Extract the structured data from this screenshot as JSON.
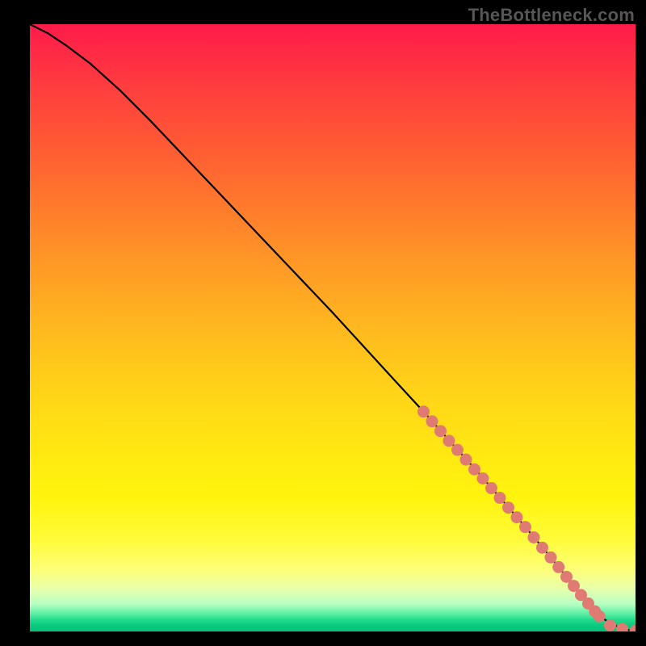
{
  "watermark": "TheBottleneck.com",
  "chart_data": {
    "type": "line",
    "title": "",
    "xlabel": "",
    "ylabel": "",
    "xlim": [
      0,
      100
    ],
    "ylim": [
      0,
      100
    ],
    "grid": false,
    "series": [
      {
        "name": "curve",
        "color": "#000000",
        "x": [
          0,
          3,
          6,
          10,
          15,
          20,
          30,
          40,
          50,
          60,
          65,
          70,
          74,
          78,
          82,
          86,
          89,
          91,
          93,
          95,
          97,
          99,
          100
        ],
        "y": [
          100,
          98.5,
          96.5,
          93.5,
          89.0,
          84.0,
          73.5,
          63.0,
          52.5,
          41.6,
          36.2,
          30.6,
          26.2,
          21.6,
          17.0,
          12.2,
          8.5,
          5.8,
          3.6,
          1.9,
          0.8,
          0.2,
          0.1
        ]
      }
    ],
    "dots": {
      "name": "dotted-segment",
      "color": "#e07b74",
      "radius_pct": 1.0,
      "points": [
        {
          "x": 65.0,
          "y": 36.2
        },
        {
          "x": 66.4,
          "y": 34.6
        },
        {
          "x": 67.8,
          "y": 33.0
        },
        {
          "x": 69.2,
          "y": 31.4
        },
        {
          "x": 70.6,
          "y": 29.9
        },
        {
          "x": 72.0,
          "y": 28.3
        },
        {
          "x": 73.4,
          "y": 26.7
        },
        {
          "x": 74.8,
          "y": 25.2
        },
        {
          "x": 76.2,
          "y": 23.6
        },
        {
          "x": 77.6,
          "y": 22.0
        },
        {
          "x": 79.0,
          "y": 20.4
        },
        {
          "x": 80.4,
          "y": 18.8
        },
        {
          "x": 81.8,
          "y": 17.2
        },
        {
          "x": 83.2,
          "y": 15.5
        },
        {
          "x": 84.6,
          "y": 13.8
        },
        {
          "x": 86.0,
          "y": 12.2
        },
        {
          "x": 87.3,
          "y": 10.6
        },
        {
          "x": 88.6,
          "y": 9.0
        },
        {
          "x": 89.8,
          "y": 7.5
        },
        {
          "x": 91.0,
          "y": 6.0
        },
        {
          "x": 92.2,
          "y": 4.6
        },
        {
          "x": 93.3,
          "y": 3.3
        },
        {
          "x": 94.0,
          "y": 2.5
        },
        {
          "x": 95.8,
          "y": 1.0
        },
        {
          "x": 97.8,
          "y": 0.4
        },
        {
          "x": 100.0,
          "y": 0.1
        }
      ]
    }
  }
}
